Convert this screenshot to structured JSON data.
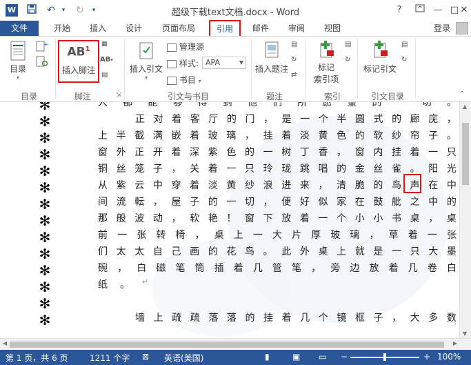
{
  "window": {
    "title": "超级下载text文档.docx - Word",
    "app_icon": "W",
    "help": "?",
    "minimize": "—",
    "restore": "□",
    "close": "✕"
  },
  "tabs": {
    "file": "文件",
    "items": [
      "开始",
      "插入",
      "设计",
      "页面布局",
      "引用",
      "邮件",
      "审阅",
      "视图"
    ],
    "active": "引用",
    "login": "登录"
  },
  "ribbon": {
    "toc": {
      "button": "目录",
      "group": "目录"
    },
    "footnote": {
      "icon_text": "AB",
      "icon_sup": "1",
      "button": "插入脚注",
      "group": "脚注",
      "small_icon_text": "AB"
    },
    "citations": {
      "insert_citation": "插入引文",
      "manage_sources": "管理源",
      "style_label": "样式:",
      "style_value": "APA",
      "bibliography": "书目",
      "group": "引文与书目"
    },
    "captions": {
      "insert_caption": "插入题注",
      "group": "题注"
    },
    "index": {
      "mark_entry_1": "标记",
      "mark_entry_2": "索引项",
      "group": "索引"
    },
    "toa": {
      "mark_citation": "标记引文",
      "group": "引文目录"
    }
  },
  "document": {
    "lines": [
      {
        "chars": [
          "人",
          "都",
          "能",
          "够",
          "得",
          "到",
          "他",
          "们",
          "所",
          "愿",
          "望",
          "的",
          "一",
          "切",
          "。"
        ],
        "indent": false,
        "short": false
      },
      {
        "chars": [
          "正",
          "对",
          "着",
          "客",
          "厅",
          "的",
          "门",
          "，",
          "是",
          "一",
          "个",
          "半",
          "圆",
          "式",
          "的",
          "廊",
          "庑",
          "，"
        ],
        "indent": true,
        "short": false
      },
      {
        "chars": [
          "上",
          "半",
          "截",
          "满",
          "嵌",
          "着",
          "玻",
          "璃",
          "，",
          "挂",
          "着",
          "淡",
          "黄",
          "色",
          "的",
          "软",
          "纱",
          "帘",
          "子",
          "。"
        ],
        "indent": false,
        "short": false
      },
      {
        "chars": [
          "窗",
          "外",
          "正",
          "开",
          "着",
          "深",
          "紫",
          "色",
          "的",
          "一",
          "树",
          "丁",
          "香",
          "，",
          "窗",
          "内",
          "挂",
          "着",
          "一",
          "只"
        ],
        "indent": false,
        "short": false
      },
      {
        "chars": [
          "铜",
          "丝",
          "笼",
          "子",
          "，",
          "关",
          "着",
          "一",
          "只",
          "玲",
          "珑",
          "跳",
          "唱",
          "的",
          "金",
          "丝",
          "雀",
          "。",
          "阳",
          "光"
        ],
        "indent": false,
        "short": false
      },
      {
        "chars": [
          "从",
          "紫",
          "云",
          "中",
          "穿",
          "着",
          "淡",
          "黄",
          "纱",
          "浪",
          "进",
          "来",
          "，",
          "清",
          "脆",
          "的",
          "鸟",
          "声",
          "在",
          "中"
        ],
        "indent": false,
        "short": false
      },
      {
        "chars": [
          "间",
          "流",
          "転",
          "，",
          "屋",
          "子",
          "的",
          "一",
          "切",
          "，",
          "便",
          "好",
          "似",
          "家",
          "在",
          "鼓",
          "舭",
          "之",
          "中",
          "的"
        ],
        "indent": false,
        "short": false
      },
      {
        "chars": [
          "那",
          "般",
          "波",
          "动",
          "，",
          "软",
          "艳",
          "！",
          "窗",
          "下",
          "放",
          "着",
          "一",
          "个",
          "小",
          "小",
          "书",
          "桌",
          "，",
          "桌"
        ],
        "indent": false,
        "short": false
      },
      {
        "chars": [
          "前",
          "一",
          "张",
          "转",
          "椅",
          "，",
          "桌",
          "上",
          "一",
          "大",
          "片",
          "厚",
          "玻",
          "璃",
          "，",
          "草",
          "着",
          "一",
          "张"
        ],
        "indent": false,
        "short": false
      },
      {
        "chars": [
          "们",
          "太",
          "太",
          "自",
          "己",
          "画",
          "的",
          "花",
          "鸟",
          "。",
          "此",
          "外",
          "桌",
          "上",
          "就",
          "是",
          "一",
          "只",
          "大",
          "墨"
        ],
        "indent": false,
        "short": false
      },
      {
        "chars": [
          "碗",
          "，",
          "白",
          "磁",
          "笔",
          "筒",
          "插",
          "着",
          "几",
          "管",
          "笔",
          "，",
          "旁",
          "边",
          "放",
          "着",
          "几",
          "卷",
          "白"
        ],
        "indent": false,
        "short": false
      },
      {
        "chars": [
          "纸",
          "。"
        ],
        "indent": false,
        "short": true,
        "pilcrow": "↵"
      },
      {
        "chars": [],
        "indent": false,
        "short": true
      },
      {
        "chars": [
          "墙",
          "上",
          "疏",
          "疏",
          "落",
          "落",
          "的",
          "挂",
          "着",
          "几",
          "个",
          "镜",
          "框",
          "子",
          "，",
          "大",
          "多",
          "数"
        ],
        "indent": true,
        "short": false
      }
    ]
  },
  "status": {
    "page": "第 1 页，共 6 页",
    "words": "1211 个字",
    "language": "英语(美国)",
    "zoom": "100%",
    "zoom_minus": "−",
    "zoom_plus": "+",
    "zoom_level_fraction": 0.5
  },
  "colors": {
    "accent": "#2b579a",
    "highlight_red": "#d8181f"
  }
}
